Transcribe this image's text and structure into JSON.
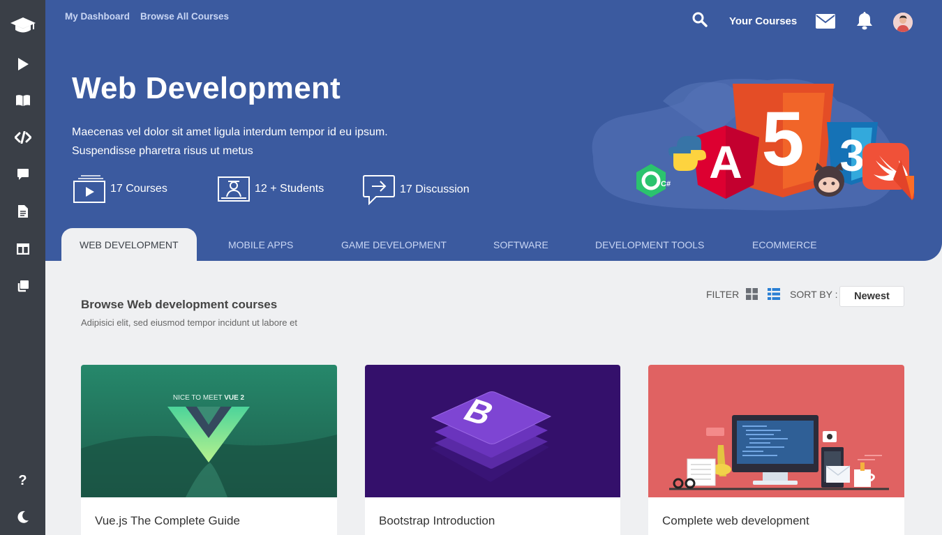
{
  "sidebar": {
    "items": [
      {
        "name": "graduation-cap-icon"
      },
      {
        "name": "play-icon"
      },
      {
        "name": "book-icon"
      },
      {
        "name": "code-icon"
      },
      {
        "name": "chat-icon"
      },
      {
        "name": "document-icon"
      },
      {
        "name": "columns-icon"
      },
      {
        "name": "copy-icon"
      }
    ],
    "bottom": [
      {
        "name": "help-icon",
        "label": "?"
      },
      {
        "name": "moon-icon"
      }
    ]
  },
  "topnav": {
    "links": [
      "My Dashboard",
      "Browse All Courses"
    ],
    "your_courses": "Your Courses"
  },
  "hero": {
    "title": "Web Development",
    "desc_line1": "Maecenas vel dolor sit amet ligula interdum tempor id eu ipsum.",
    "desc_line2": "Suspendisse pharetra risus ut metus",
    "stats": {
      "courses": "17 Courses",
      "students": "12 + Students",
      "discussion": "17 Discussion"
    }
  },
  "tabs": [
    "WEB DEVELOPMENT",
    "MOBILE APPS",
    "GAME DEVELOPMENT",
    "SOFTWARE",
    "DEVELOPMENT TOOLS",
    "ECOMMERCE"
  ],
  "browse": {
    "title": "Browse Web development courses",
    "subtitle": "Adipisici elit, sed eiusmod tempor incidunt ut labore et",
    "filter_label": "FILTER",
    "sort_label": "SORT BY :",
    "sort_value": "Newest"
  },
  "cards": [
    {
      "title": "Vue.js The Complete Guide",
      "banner_small": "NICE TO MEET",
      "banner_bold": "VUE 2"
    },
    {
      "title": "Bootstrap Introduction"
    },
    {
      "title": "Complete web development"
    }
  ],
  "illustration_badges": {
    "csharp": "C#",
    "angular": "A",
    "html": "5",
    "css": "3"
  },
  "colors": {
    "sidebar": "#3a3f47",
    "hero": "#3b5a9f",
    "background": "#eff0f2",
    "accent_blue": "#2a7fd4"
  }
}
